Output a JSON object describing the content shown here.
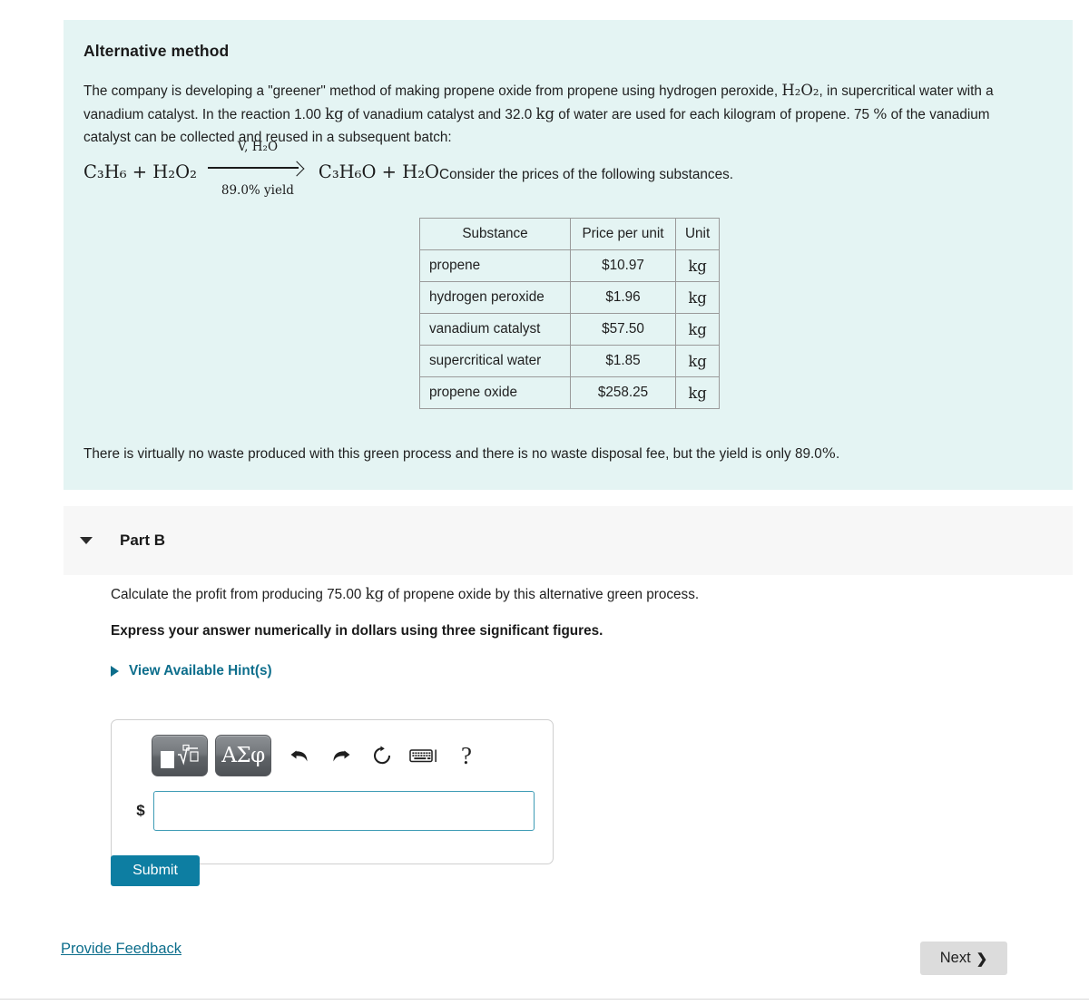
{
  "problem": {
    "title": "Alternative method",
    "paragraph_1": "The company is developing a \"greener\" method of making propene oxide from propene using hydrogen peroxide, ",
    "formula_h2o2": "H₂O₂",
    "paragraph_2": ", in supercritical water with a vanadium catalyst. In the reaction 1.00 ",
    "unit_kg_1": "kg",
    "paragraph_3": " of vanadium catalyst and 32.0 ",
    "unit_kg_2": "kg",
    "paragraph_4": " of water are used for each kilogram of propene. 75 ",
    "percent_sign": "%",
    "paragraph_5": " of the vanadium catalyst can be collected and reused in a subsequent batch:",
    "waste_note_pre": "There is virtually no waste produced with this green process and there is no waste disposal fee, but the yield is only 89.0",
    "waste_note_percent": "%",
    "waste_note_post": "."
  },
  "reaction": {
    "reactants": "C₃H₆ + H₂O₂",
    "above_arrow": "V, H₂O",
    "below_arrow": "89.0% yield",
    "products": "C₃H₆O + H₂O",
    "trailing_text": "Consider the prices of the following substances."
  },
  "price_table": {
    "headers": [
      "Substance",
      "Price per unit",
      "Unit"
    ],
    "rows": [
      {
        "substance": "propene",
        "price": "$10.97",
        "unit": "kg"
      },
      {
        "substance": "hydrogen peroxide",
        "price": "$1.96",
        "unit": "kg"
      },
      {
        "substance": "vanadium catalyst",
        "price": "$57.50",
        "unit": "kg"
      },
      {
        "substance": "supercritical water",
        "price": "$1.85",
        "unit": "kg"
      },
      {
        "substance": "propene oxide",
        "price": "$258.25",
        "unit": "kg"
      }
    ]
  },
  "part": {
    "label": "Part B",
    "expanded": true,
    "question_pre": "Calculate the profit from producing 75.00 ",
    "question_unit": "kg",
    "question_post": " of propene oxide by this alternative green process.",
    "instruction": "Express your answer numerically in dollars using three significant figures.",
    "hints_label": "View Available Hint(s)"
  },
  "answer": {
    "toolbar": {
      "template_label": "math-template",
      "greek_label": "ΑΣφ",
      "undo_label": "undo",
      "redo_label": "redo",
      "reset_label": "reset",
      "keyboard_label": "keyboard",
      "help_label": "?"
    },
    "prefix": "$",
    "value": "",
    "placeholder": ""
  },
  "actions": {
    "submit_label": "Submit",
    "feedback_label": "Provide Feedback",
    "next_label": "Next",
    "next_chevron": "❯"
  },
  "colors": {
    "panel_background": "#e4f4f3",
    "part_header_background": "#f7f7f7",
    "accent_link": "#0d6e8c",
    "submit_background": "#0d7ea2",
    "input_border": "#3d9bb5",
    "next_background": "#dcdcdc"
  }
}
